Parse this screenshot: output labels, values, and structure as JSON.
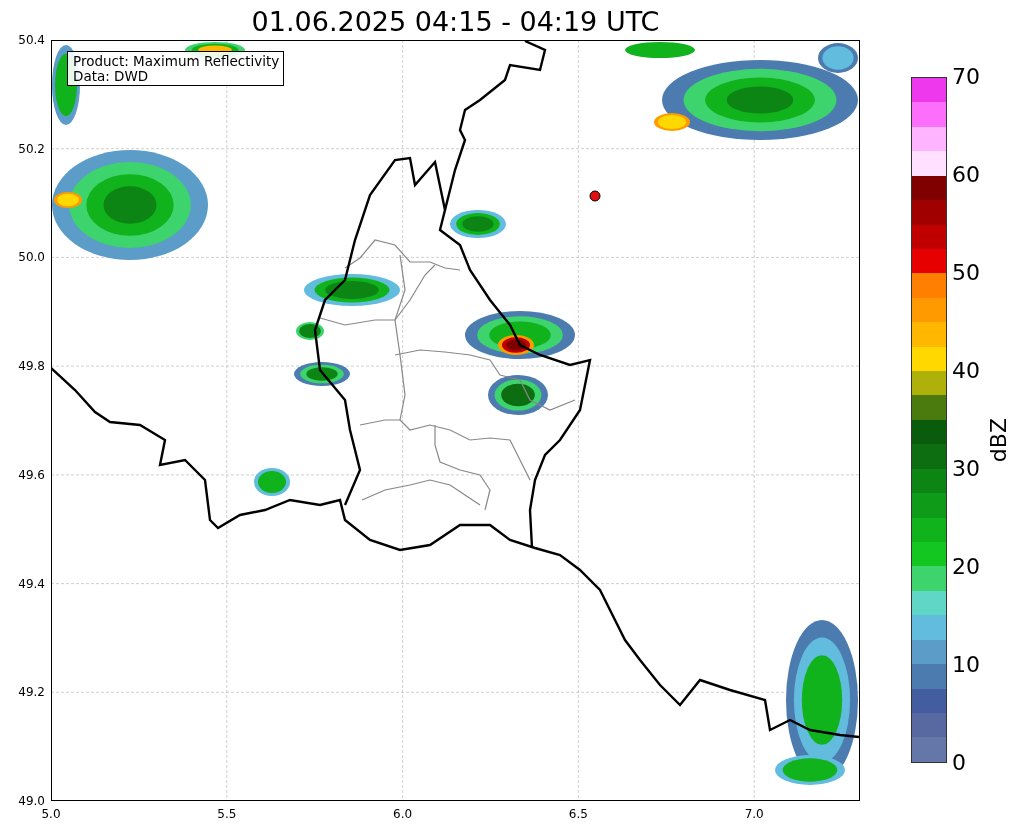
{
  "title": "01.06.2025 04:15 - 04:19 UTC",
  "legend": {
    "lines": [
      "Product: Maximum Reflectivity",
      "Data: DWD"
    ]
  },
  "map": {
    "x_ticks": [
      "5.0",
      "5.5",
      "6.0",
      "6.5",
      "7.0"
    ],
    "y_ticks": [
      "50.4",
      "50.2",
      "50.0",
      "49.8",
      "49.6",
      "49.4",
      "49.2",
      "49.0"
    ]
  },
  "colorbar": {
    "label": "dBZ",
    "ticks": [
      "70",
      "60",
      "50",
      "40",
      "30",
      "20",
      "10",
      "0"
    ],
    "segments": [
      {
        "color": "#ee38ee"
      },
      {
        "color": "#fb6ffb"
      },
      {
        "color": "#ffb4ff"
      },
      {
        "color": "#ffe0ff"
      },
      {
        "color": "#800000"
      },
      {
        "color": "#a00000"
      },
      {
        "color": "#c00000"
      },
      {
        "color": "#e60000"
      },
      {
        "color": "#ff7f00"
      },
      {
        "color": "#ff9b00"
      },
      {
        "color": "#ffb700"
      },
      {
        "color": "#ffd800"
      },
      {
        "color": "#aeb10a"
      },
      {
        "color": "#4b7a0e"
      },
      {
        "color": "#0a5c0d"
      },
      {
        "color": "#0c6e10"
      },
      {
        "color": "#0c8514"
      },
      {
        "color": "#0e9c18"
      },
      {
        "color": "#10b31c"
      },
      {
        "color": "#14c620"
      },
      {
        "color": "#3dd46e"
      },
      {
        "color": "#60d6c6"
      },
      {
        "color": "#62bcdd"
      },
      {
        "color": "#5b9cc8"
      },
      {
        "color": "#4c7bb0"
      },
      {
        "color": "#445da0"
      },
      {
        "color": "#5868a0"
      },
      {
        "color": "#6577a8"
      }
    ]
  }
}
